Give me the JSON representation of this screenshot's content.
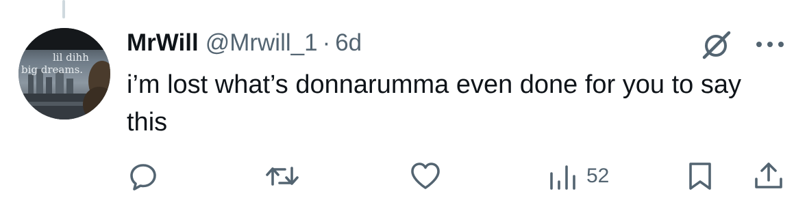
{
  "tweet": {
    "display_name": "MrWill",
    "handle": "@Mrwill_1",
    "separator": "·",
    "timestamp": "6d",
    "text": "i’m lost what’s donnarumma even done for you to say this",
    "avatar_text": {
      "line1": "lil dihh",
      "line2": "big dreams."
    }
  },
  "actions": {
    "reply_icon": "comment-bubble-icon",
    "retweet_icon": "retweet-icon",
    "like_icon": "heart-icon",
    "views_icon": "bar-chart-icon",
    "views_count": "52",
    "bookmark_icon": "bookmark-icon",
    "share_icon": "share-upload-icon"
  },
  "header_icons": {
    "grok": "grok-slash-icon",
    "more": "more-dots-icon"
  },
  "colors": {
    "text_primary": "#0f1419",
    "text_secondary": "#536471",
    "thread_line": "#cfd9de"
  }
}
